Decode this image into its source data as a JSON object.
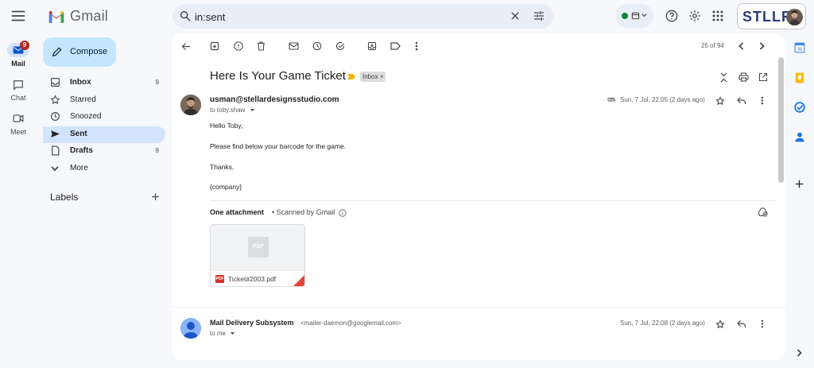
{
  "app": {
    "name": "Gmail"
  },
  "search": {
    "value": "in:sent"
  },
  "brand": {
    "text": "STLLR"
  },
  "rail": {
    "mail_label": "Mail",
    "mail_badge": "9",
    "chat_label": "Chat",
    "meet_label": "Meet"
  },
  "compose": {
    "label": "Compose"
  },
  "nav": {
    "items": [
      {
        "label": "Inbox",
        "count": "9",
        "icon": "inbox-icon"
      },
      {
        "label": "Starred",
        "count": "",
        "icon": "star-icon"
      },
      {
        "label": "Snoozed",
        "count": "",
        "icon": "clock-icon"
      },
      {
        "label": "Sent",
        "count": "",
        "icon": "send-icon"
      },
      {
        "label": "Drafts",
        "count": "9",
        "icon": "draft-icon"
      },
      {
        "label": "More",
        "count": "",
        "icon": "chevron-down-icon"
      }
    ],
    "labels_heading": "Labels"
  },
  "toolbar": {
    "pagination": "25 of 94"
  },
  "thread": {
    "subject": "Here Is Your Game Ticket",
    "label_chip": "Inbox",
    "messages": [
      {
        "sender": "usman@stellardesignsstudio.com",
        "to": "to toby.shaw",
        "date": "Sun, 7 Jul, 22:05 (2 days ago)",
        "body": [
          "Hello Toby,",
          "Please find below your barcode for the game.",
          "Thanks,",
          "{company}"
        ],
        "attachment_title": "One attachment",
        "attachment_scan": "• Scanned by Gmail",
        "attachment_name": "Ticket#2003.pdf",
        "attachment_type": "PDF"
      },
      {
        "sender": "Mail Delivery Subsystem",
        "sender_email": "<mailer-daemon@googlemail.com>",
        "to": "to me",
        "date": "Sun, 7 Jul, 22:08 (2 days ago)"
      }
    ]
  },
  "colors": {
    "background": "#f6f8fc",
    "compose": "#c2e7ff",
    "active_nav": "#d3e3fd",
    "badge": "#b3261e",
    "pdf_red": "#d93025"
  }
}
